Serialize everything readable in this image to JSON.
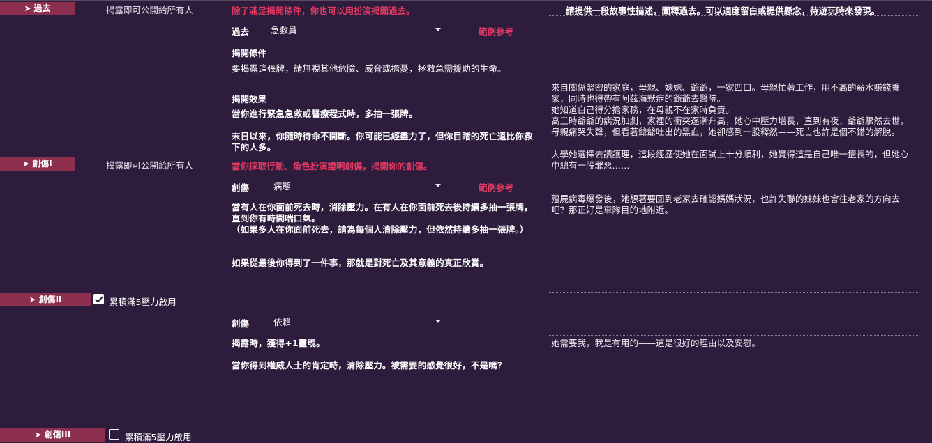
{
  "past": {
    "tag_arrow": "➤",
    "tag_label": "過去",
    "reveal_to": "揭露即可公開給所有人",
    "warning": "除了滿足揭開條件，你也可以用扮演揭開過去。",
    "select_label": "過去",
    "select_value": "急救員",
    "example_link": "範例參考",
    "condition_heading": "揭開條件",
    "condition_text": "要揭露這張牌，請無視其他危險、威脅或擔憂，拯救急需援助的生命。",
    "effect_heading": "揭開效果",
    "effect_line1": "當你進行緊急急救或醫療程式時，多抽一張牌。",
    "effect_line2": "末日以來，你隨時待命不間斷。你可能已經盡力了，但你目睹的死亡遠比你救下的人多。",
    "story_prompt": "請提供一段故事性描述，闡釋過去。可以適度留白或提供懸念，待遊玩時來發現。",
    "story_text": "來自關係緊密的家庭，母親、妹妹、爺爺，一家四口。母親忙著工作，用不高的薪水賺錢養家，同時也得帶有阿茲海默症的爺爺去醫院。\n她知道自己得分擔家務，在母親不在家時負責。\n高三時爺爺的病況加劇，家裡的衝突逐漸升高，她心中壓力增長，直到有夜，爺爺驟然去世，母親痛哭失聲，但看著爺爺吐出的黑血，她卻感到一股釋然——死亡也許是個不錯的解脫。\n\n大學她選擇去讀護理，這段經歷使她在面試上十分順利，她覺得這是自己唯一擅長的，但她心中總有一股罪惡……\n\n\n殭屍病毒爆發後，她想著要回到老家去確認媽媽狀況，也許失聯的妹妹也會往老家的方向去吧？那正好是車隊目的地附近。"
  },
  "trauma1": {
    "tag_arrow": "➤",
    "tag_label": "創傷I",
    "reveal_to": "揭露即可公開給所有人",
    "warning": "當你採取行動、角色扮演證明創傷，揭開你的創傷。",
    "select_label": "創傷",
    "select_value": "病態",
    "example_link": "範例參考",
    "text_line1": "當有人在你面前死去時，消除壓力。在有人在你面前死去後持續多抽一張牌，直到你有時間喘口氣。",
    "text_line2": "（如果多人在你面前死去，請為每個人清除壓力，但依然持續多抽一張牌。）",
    "text_line3": "如果從最後你得到了一件事，那就是對死亡及其意義的真正欣賞。"
  },
  "trauma2": {
    "tag_arrow": "➤",
    "tag_label": "創傷II",
    "checkbox_label": "累積滿5壓力啟用",
    "checked": true,
    "select_label": "創傷",
    "select_value": "依賴",
    "text_line1": "揭露時，獲得+1靈魂。",
    "text_line2": "當你得到權威人士的肯定時，清除壓力。被需要的感覺很好，不是嗎？",
    "story_text": "她需要我，我是有用的——這是很好的理由以及安慰。"
  },
  "trauma3": {
    "tag_arrow": "➤",
    "tag_label": "創傷III",
    "checkbox_label": "累積滿5壓力啟用",
    "checked": false
  }
}
